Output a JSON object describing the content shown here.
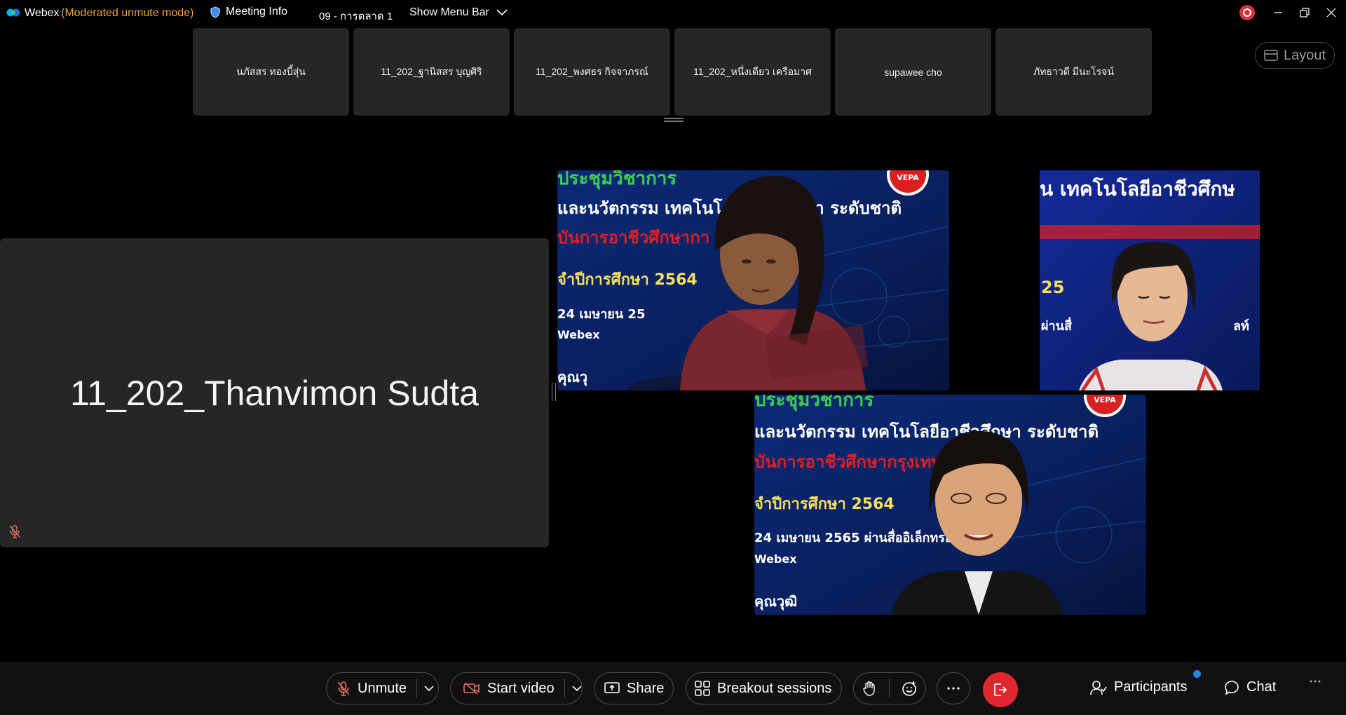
{
  "titlebar": {
    "app_name": "Webex",
    "mode": "(Moderated unmute mode)",
    "meeting_info_label": "Meeting Info",
    "meeting_title": "09 - การตลาด 1",
    "show_menu_bar_label": "Show Menu Bar"
  },
  "filmstrip": {
    "participants": [
      "นภัสสร ทองบี้สุ่น",
      "11_202_ฐานิสสร บุญศิริ",
      "11_202_พงศธร กิจจาภรณ์",
      "11_202_หนึ่งเดียว เครือมาศ",
      "supawee cho",
      "ภัทธาวดี มีนะโรจน์"
    ]
  },
  "layout_button": {
    "label": "Layout"
  },
  "stage": {
    "name_tile": {
      "participant_name": "11_202_Thanvimon Sudta",
      "muted": true
    },
    "video_tiles": [
      {
        "lines": [
          "ประชุมวิชาการ",
          "และนวัตกรรม เทคโนโลยีอาชีวศึกษา ระดับชาติ",
          "บันการอาชีวศึกษากา",
          "จำปีการศึกษา 2564",
          "24 เมษายน 25",
          "Webex",
          "คุณวุ"
        ],
        "badge": "VEPA"
      },
      {
        "lines": [
          "น เทคโนโลยีอาชีวศึกษ",
          "25",
          "ผ่านสื่",
          "ลท์"
        ]
      },
      {
        "lines": [
          "ประชุมวิชาการ",
          "และนวัตกรรม เทคโนโลยีอาชีวศึกษา ระดับชาติ",
          "บันการอาชีวศึกษากรุงเทพมหา",
          "จำปีการศึกษา 2564",
          "24 เมษายน 2565 ผ่านสื่ออิเล็กทรอนิกส์",
          "Webex",
          "คุณวุฒิ"
        ],
        "badge": "VEPA"
      }
    ]
  },
  "toolbar": {
    "unmute_label": "Unmute",
    "start_video_label": "Start video",
    "share_label": "Share",
    "breakout_label": "Breakout sessions",
    "participants_label": "Participants",
    "chat_label": "Chat"
  },
  "colors": {
    "mode_text": "#f0a030",
    "leave_button": "#e0262e",
    "muted_icon": "#e06b6b",
    "notification_dot": "#1e88e5",
    "tile_background": "#262626"
  }
}
